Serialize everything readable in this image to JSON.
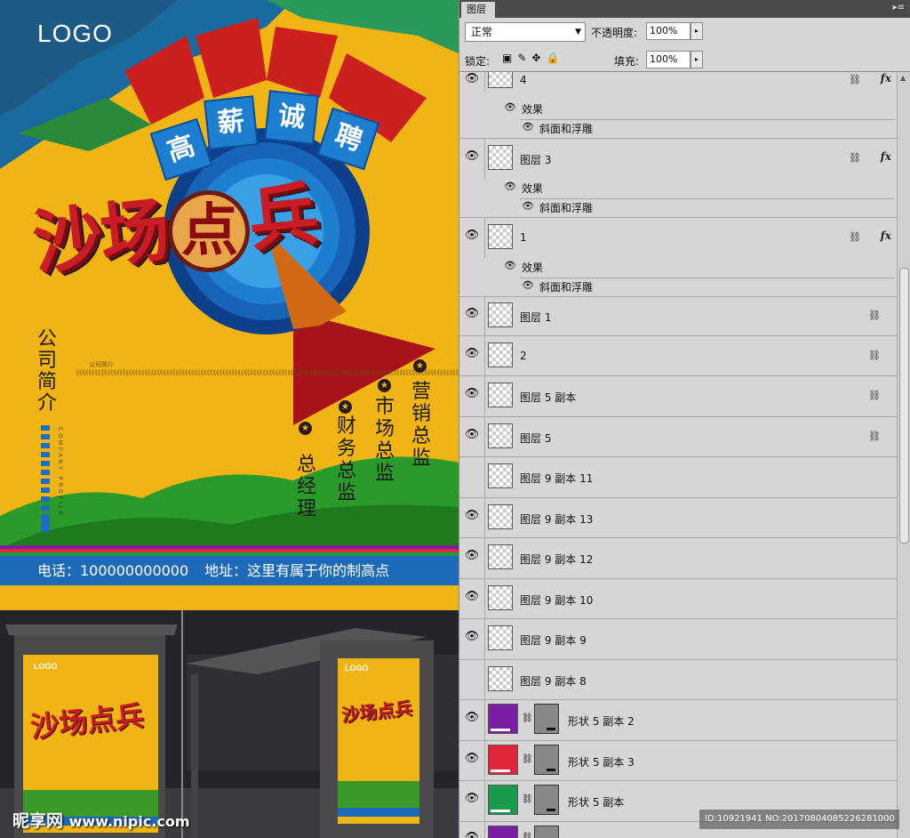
{
  "poster": {
    "logo": "LOGO",
    "banner": [
      "高",
      "薪",
      "诚",
      "聘"
    ],
    "title_parts": [
      "沙场",
      "点",
      "兵"
    ],
    "company_title": "公司简介",
    "company_profile_en": "COMPANY PROFILE",
    "desc_head": "公司简介",
    "positions": [
      "总经理",
      "财务总监",
      "市场总监",
      "营销总监"
    ],
    "footer_phone": "电话：100000000000",
    "footer_address": "地址：这里有属于你的制高点",
    "colors": {
      "background": "#f0b415",
      "accent_red": "#c81d25",
      "footer_blue": "#1f6ab8",
      "green": "#3a9a2a"
    }
  },
  "photo": {
    "mini_logo": "LOGO",
    "mini_title": "沙场点兵"
  },
  "watermark": {
    "brand": "昵享网",
    "url": "www.nipic.com"
  },
  "id_badge": "ID:10921941 NO:20170804085226281000",
  "panel": {
    "tab": "图层",
    "blend_mode": "正常",
    "opacity_label": "不透明度:",
    "opacity_value": "100%",
    "lock_label": "锁定:",
    "fill_label": "填充:",
    "fill_value": "100%",
    "effects_label": "效果",
    "bevel_label": "斜面和浮雕",
    "layers": [
      {
        "name": "4",
        "visible": true,
        "fx": true
      },
      {
        "name": "图层 3",
        "visible": true,
        "fx": true
      },
      {
        "name": "1",
        "visible": true,
        "fx": true
      },
      {
        "name": "图层 1",
        "visible": true,
        "fx": false
      },
      {
        "name": "2",
        "visible": true,
        "fx": false
      },
      {
        "name": "图层 5 副本",
        "visible": true,
        "fx": false
      },
      {
        "name": "图层 5",
        "visible": true,
        "fx": false
      },
      {
        "name": "图层 9 副本 11",
        "visible": false,
        "fx": false
      },
      {
        "name": "图层 9 副本 13",
        "visible": true,
        "fx": false
      },
      {
        "name": "图层 9 副本 12",
        "visible": true,
        "fx": false
      },
      {
        "name": "图层 9 副本 10",
        "visible": true,
        "fx": false
      },
      {
        "name": "图层 9 副本 9",
        "visible": true,
        "fx": false
      },
      {
        "name": "图层 9 副本 8",
        "visible": false,
        "fx": false
      },
      {
        "name": "形状 5 副本 2",
        "visible": true,
        "fx": false,
        "color": "#7b1fa2"
      },
      {
        "name": "形状 5 副本 3",
        "visible": true,
        "fx": false,
        "color": "#e0283a"
      },
      {
        "name": "形状 5 副本",
        "visible": true,
        "fx": false,
        "color": "#1a9a4a"
      },
      {
        "name": "",
        "visible": true,
        "fx": false,
        "color": "#7b1fa2"
      }
    ]
  }
}
